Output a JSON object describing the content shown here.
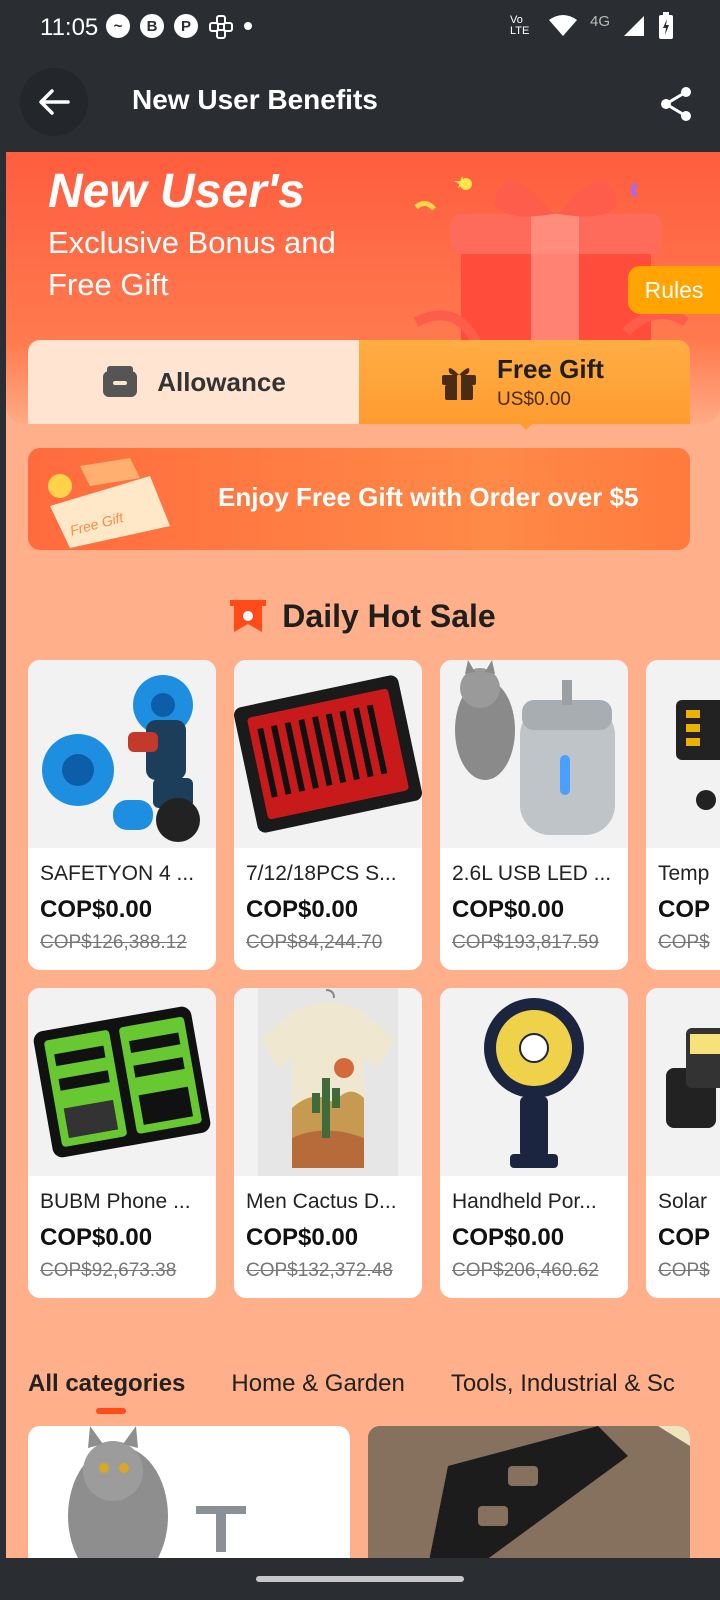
{
  "status_bar": {
    "time": "11:05",
    "network": "4G",
    "app_icons": [
      "messenger-icon",
      "b-icon",
      "p-icon",
      "game-icon"
    ],
    "lte_label": "Vo LTE"
  },
  "header": {
    "title": "New User Benefits"
  },
  "banner": {
    "title": "New User's",
    "subtitle": "Exclusive Bonus and Free Gift",
    "rules_label": "Rules"
  },
  "tabs": {
    "allowance_label": "Allowance",
    "free_gift_label": "Free Gift",
    "free_gift_value": "US$0.00"
  },
  "promo": {
    "ticket_text": "Free Gift",
    "message": "Enjoy Free Gift with Order over $5"
  },
  "hot_sale": {
    "title": "Daily Hot Sale",
    "products": [
      {
        "name": "SAFETYON 4 ...",
        "price": "COP$0.00",
        "original": "COP$126,388.12"
      },
      {
        "name": "7/12/18PCS S...",
        "price": "COP$0.00",
        "original": "COP$84,244.70"
      },
      {
        "name": "2.6L USB LED ...",
        "price": "COP$0.00",
        "original": "COP$193,817.59"
      },
      {
        "name": "Temp",
        "price": "COP",
        "original": "COP$"
      },
      {
        "name": "BUBM Phone ...",
        "price": "COP$0.00",
        "original": "COP$92,673.38"
      },
      {
        "name": "Men Cactus D...",
        "price": "COP$0.00",
        "original": "COP$132,372.48"
      },
      {
        "name": "Handheld Por...",
        "price": "COP$0.00",
        "original": "COP$206,460.62"
      },
      {
        "name": "Solar",
        "price": "COP",
        "original": "COP$"
      }
    ]
  },
  "categories": {
    "tabs": [
      "All categories",
      "Home & Garden",
      "Tools, Industrial & Sc"
    ]
  },
  "colors": {
    "accent": "#ff5d3e",
    "tab_gift": "#ff9c2f",
    "page_bg": "#ffb08b"
  }
}
